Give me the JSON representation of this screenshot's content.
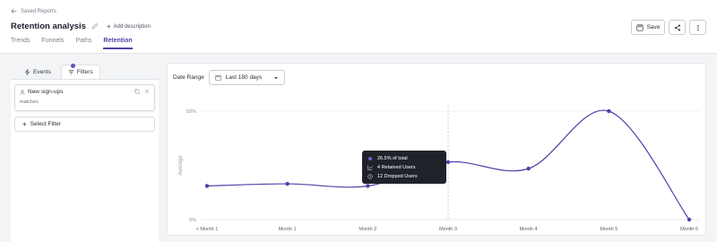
{
  "header": {
    "back_label": "Saved Reports",
    "title": "Retention analysis",
    "add_description": "Add description",
    "tabs": [
      {
        "label": "Trends",
        "active": false
      },
      {
        "label": "Funnels",
        "active": false
      },
      {
        "label": "Paths",
        "active": false
      },
      {
        "label": "Retention",
        "active": true
      }
    ],
    "save_label": "Save"
  },
  "left_panel": {
    "tabs": [
      {
        "label": "Events",
        "active": false
      },
      {
        "label": "Filters",
        "active": true
      }
    ],
    "filter": {
      "name": "New sign-ups",
      "subtitle": "matches"
    },
    "select_filter_label": "Select Filter"
  },
  "date_range": {
    "label": "Date Range",
    "value": "Last 180 days"
  },
  "chart_data": {
    "type": "line",
    "ylabel": "Average",
    "yticks": [
      "0%",
      "50%"
    ],
    "ylim": [
      0,
      50
    ],
    "categories": [
      "< Month 1",
      "Month 1",
      "Month 2",
      "Month 3",
      "Month 4",
      "Month 5",
      "Month 6"
    ],
    "values": [
      15.5,
      16.5,
      15.5,
      26.5,
      23.5,
      50,
      0
    ],
    "series_color": "#4b44a8",
    "highlighted_category": "Month 3"
  },
  "tooltip": {
    "line1": "26.5% of total",
    "line2": "4 Retained Users",
    "line3": "12 Dropped Users"
  },
  "colors": {
    "accent": "#4f46a5",
    "tooltip_bg": "#1f2329"
  }
}
